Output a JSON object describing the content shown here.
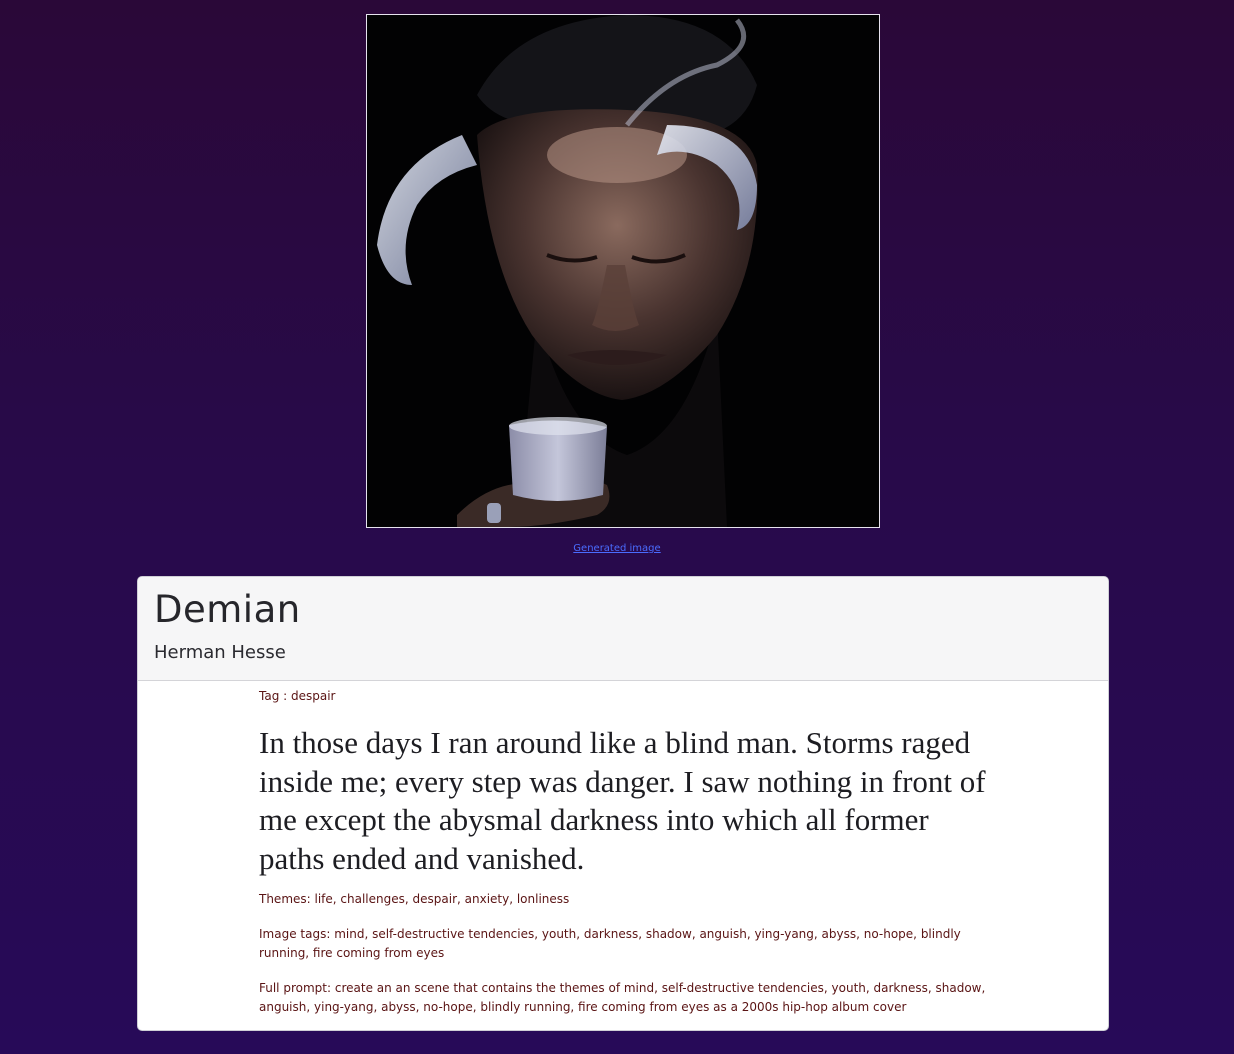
{
  "image": {
    "link_text": "Generated image"
  },
  "book": {
    "title": "Demian",
    "author": "Herman Hesse"
  },
  "tag": {
    "label": "Tag :",
    "value": "despair"
  },
  "quote": "In those days I ran around like a blind man. Storms raged inside me; every step was danger. I saw nothing in front of me except the abysmal darkness into which all former paths ended and vanished.",
  "themes": {
    "label": "Themes:",
    "value": "life, challenges, despair, anxiety, lonliness"
  },
  "image_tags": {
    "label": "Image tags:",
    "value": "mind, self-destructive tendencies, youth, darkness, shadow, anguish, ying-yang, abyss, no-hope, blindly running, fire coming from eyes"
  },
  "full_prompt": {
    "label": "Full prompt:",
    "value": "create an an scene that contains the themes of mind, self-destructive tendencies, youth, darkness, shadow, anguish, ying-yang, abyss, no-hope, blindly running, fire coming from eyes as a 2000s hip-hop album cover"
  },
  "colors": {
    "background_top": "#2a0838",
    "background_bottom": "#270a58",
    "link": "#4a6cff",
    "meta_text": "#5a1414",
    "card_header": "#f6f6f7"
  }
}
